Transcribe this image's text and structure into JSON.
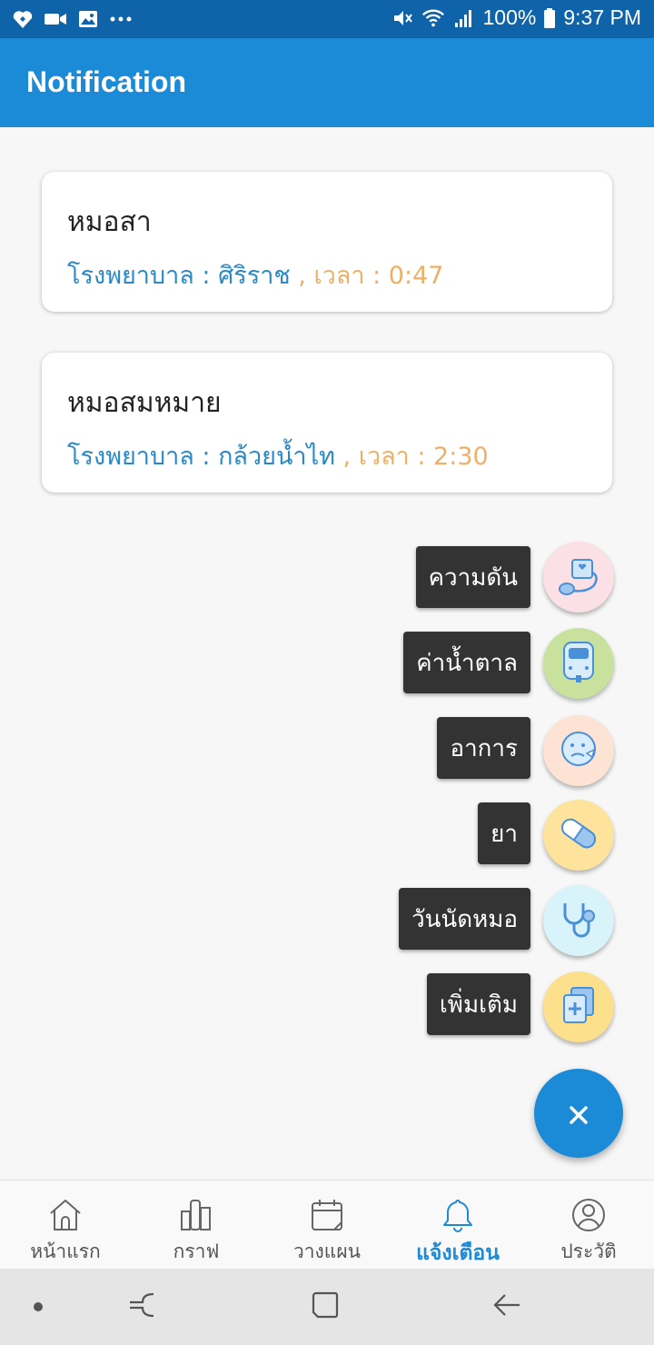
{
  "status_bar": {
    "left_icons": [
      "heart-app-icon",
      "video-call-icon",
      "image-icon",
      "more-dots-icon"
    ],
    "battery": "100%",
    "time": "9:37 PM",
    "right_icons": [
      "mute-icon",
      "wifi-icon",
      "signal-icon",
      "battery-icon"
    ]
  },
  "app_bar": {
    "title": "Notification"
  },
  "notifications": [
    {
      "title": "หมอสา",
      "hospital": "โรงพยาบาล : ศิริราช",
      "time": " , เวลา : 0:47"
    },
    {
      "title": "หมอสมหมาย",
      "hospital": "โรงพยาบาล : กล้วยน้ำไท",
      "time": " , เวลา : 2:30"
    }
  ],
  "speed_dial": {
    "items": [
      {
        "label": "ความดัน",
        "icon": "blood-pressure-icon",
        "color": "#fbe0e6"
      },
      {
        "label": "ค่าน้ำตาล",
        "icon": "glucose-meter-icon",
        "color": "#c8e29d"
      },
      {
        "label": "อาการ",
        "icon": "sick-face-icon",
        "color": "#fde3d3"
      },
      {
        "label": "ยา",
        "icon": "pill-icon",
        "color": "#fde39b"
      },
      {
        "label": "วันนัดหมอ",
        "icon": "stethoscope-icon",
        "color": "#d8f3fa"
      },
      {
        "label": "เพิ่มเติม",
        "icon": "add-document-icon",
        "color": "#fde08c"
      }
    ],
    "fab_icon": "close-icon"
  },
  "bottom_nav": {
    "items": [
      {
        "label": "หน้าแรก",
        "icon": "home-icon"
      },
      {
        "label": "กราฟ",
        "icon": "bar-chart-icon"
      },
      {
        "label": "วางแผน",
        "icon": "calendar-icon"
      },
      {
        "label": "แจ้งเตือน",
        "icon": "bell-icon",
        "active": true
      },
      {
        "label": "ประวัติ",
        "icon": "profile-icon"
      }
    ]
  },
  "colors": {
    "primary": "#1b8bd8",
    "status_bar": "#0f63a8",
    "hospital_text": "#2a8ac8",
    "time_text": "#eeb066"
  }
}
